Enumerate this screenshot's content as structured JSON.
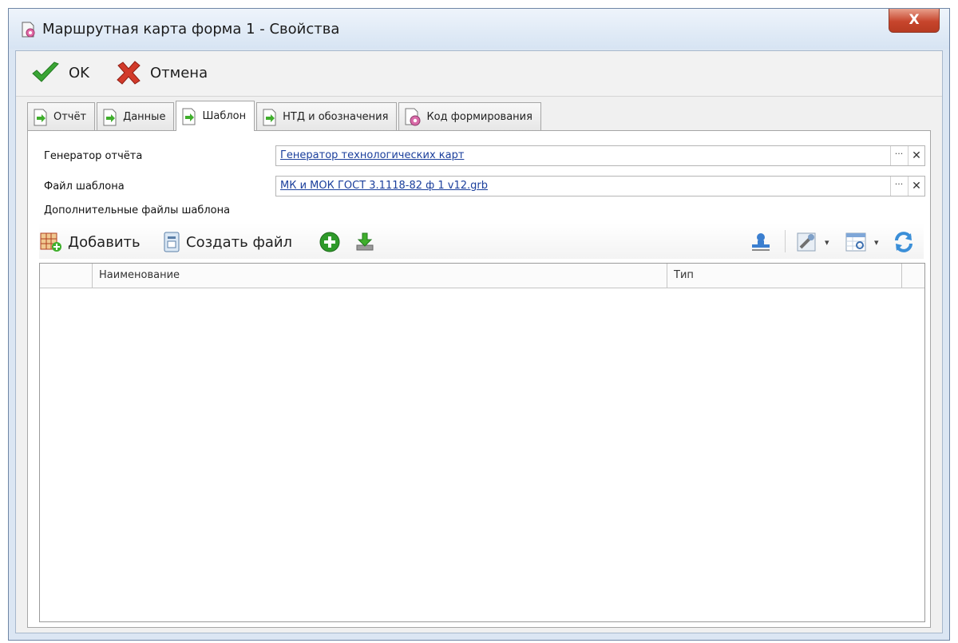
{
  "window": {
    "title": "Маршрутная карта форма 1 - Свойства",
    "close_label": "X"
  },
  "toolbar": {
    "ok_label": "OK",
    "cancel_label": "Отмена"
  },
  "tabs": [
    {
      "label": "Отчёт",
      "active": false
    },
    {
      "label": "Данные",
      "active": false
    },
    {
      "label": "Шаблон",
      "active": true
    },
    {
      "label": "НТД и обозначения",
      "active": false
    },
    {
      "label": "Код формирования",
      "active": false
    }
  ],
  "form": {
    "generator_label": "Генератор отчёта",
    "generator_value": "Генератор технологических карт",
    "template_label": "Файл шаблона",
    "template_value": "МК и МОК ГОСТ 3.1118-82 ф 1 v12.grb",
    "dots_label": "···",
    "clear_label": "✕"
  },
  "extra_files": {
    "section_label": "Дополнительные файлы шаблона",
    "add_label": "Добавить",
    "create_label": "Создать файл"
  },
  "grid": {
    "columns": [
      "",
      "Наименование",
      "Тип",
      ""
    ],
    "rows": []
  },
  "colors": {
    "link": "#1b3f9c",
    "ok_check": "#3aa535",
    "cancel_x": "#d23a2a",
    "close_button": "#c7452c"
  }
}
